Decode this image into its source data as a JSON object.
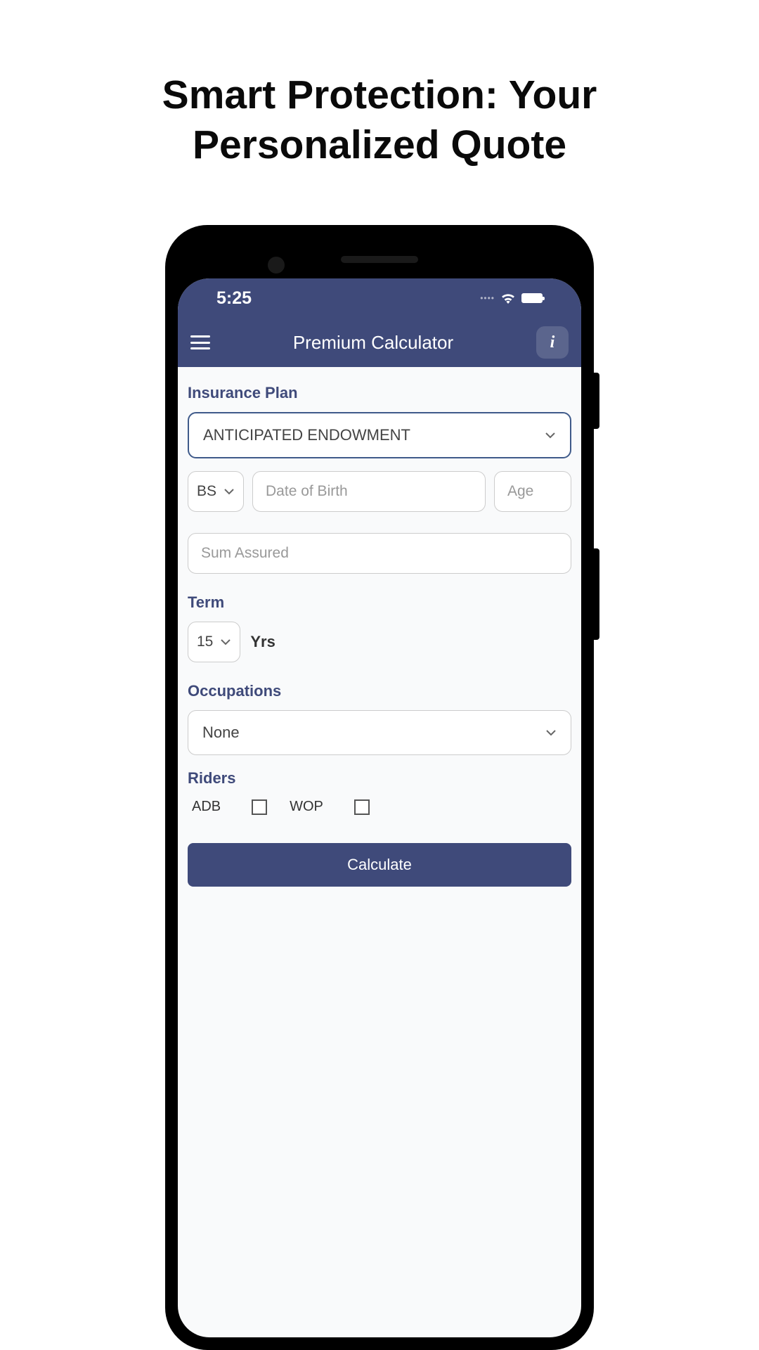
{
  "page": {
    "title": "Smart Protection: Your Personalized Quote"
  },
  "statusBar": {
    "time": "5:25"
  },
  "appBar": {
    "title": "Premium Calculator"
  },
  "form": {
    "insurancePlan": {
      "label": "Insurance Plan",
      "value": "ANTICIPATED ENDOWMENT"
    },
    "calendar": {
      "value": "BS"
    },
    "dob": {
      "placeholder": "Date of Birth"
    },
    "age": {
      "placeholder": "Age"
    },
    "sumAssured": {
      "placeholder": "Sum Assured"
    },
    "term": {
      "label": "Term",
      "value": "15",
      "unit": "Yrs"
    },
    "occupations": {
      "label": "Occupations",
      "value": "None"
    },
    "riders": {
      "label": "Riders",
      "items": [
        {
          "label": "ADB"
        },
        {
          "label": "WOP"
        }
      ]
    },
    "calculateButton": "Calculate"
  }
}
